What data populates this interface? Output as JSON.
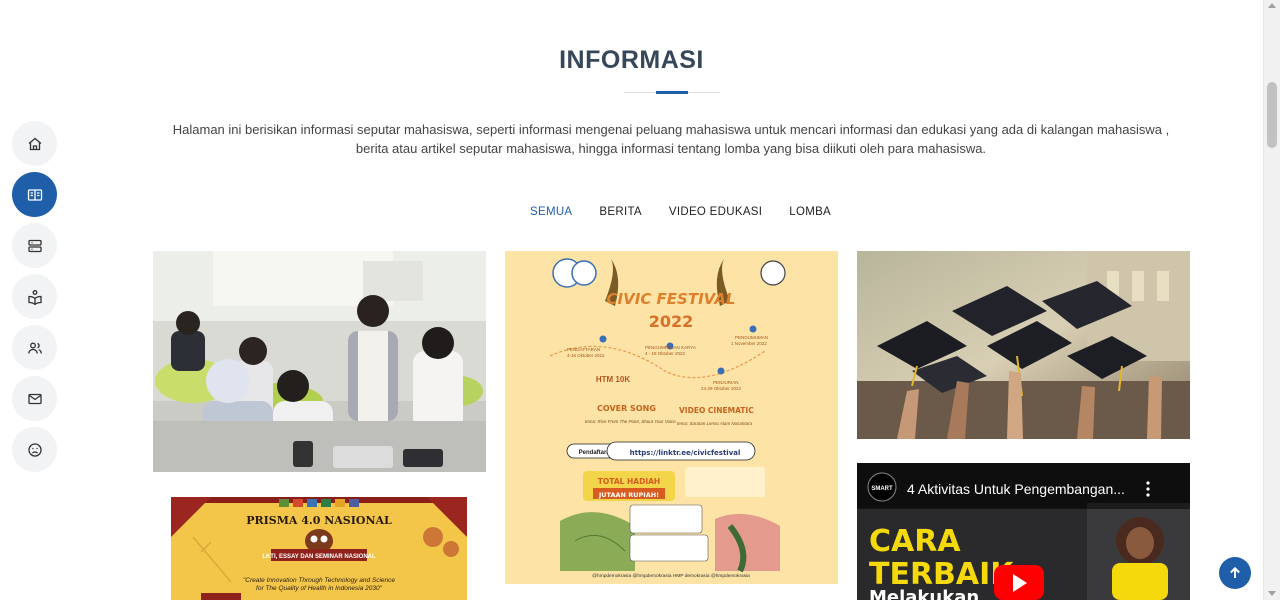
{
  "sidebar": {
    "items": [
      {
        "icon": "home-icon",
        "active": false
      },
      {
        "icon": "book-open-icon",
        "active": true
      },
      {
        "icon": "server-icon",
        "active": false
      },
      {
        "icon": "reading-icon",
        "active": false
      },
      {
        "icon": "people-icon",
        "active": false
      },
      {
        "icon": "mail-icon",
        "active": false
      },
      {
        "icon": "face-icon",
        "active": false
      }
    ]
  },
  "section": {
    "title": "INFORMASI",
    "description_line1": "Halaman ini berisikan informasi seputar mahasiswa, seperti informasi mengenai peluang mahasiswa untuk mencari informasi dan edukasi yang ada di kalangan mahasiswa ,",
    "description_line2": "berita atau artikel seputar mahasiswa, hingga informasi tentang lomba yang bisa diikuti oleh para mahasiswa."
  },
  "filters": [
    {
      "label": "SEMUA",
      "active": true
    },
    {
      "label": "BERITA",
      "active": false
    },
    {
      "label": "VIDEO EDUKASI",
      "active": false
    },
    {
      "label": "LOMBA",
      "active": false
    }
  ],
  "cards": {
    "civic": {
      "title_line1": "CIVIC FESTIVAL",
      "title_line2": "2022",
      "pendaftaran": "PENDAFTARAN",
      "pendaftaran_date": "4-16 Oktober 2022",
      "pengumpulan": "PENGUMPULAN KARYA",
      "pengumpulan_date": "4 - 18 Oktober 2022",
      "pengumuman": "PENGUMUMAN",
      "pengumuman_date": "1 November 2022",
      "penjurian": "PENJURIAN",
      "penjurian_date": "24-29 Oktober 2022",
      "htm": "HTM 10K",
      "cover_song": "COVER SONG",
      "cover_song_theme": "tema: Rise From The Point, Shout Your Voice",
      "video_cinematic": "VIDEO CINEMATIC",
      "video_cinematic_theme": "tema: Saratan Lenso Alam Nusantara",
      "pendaftaran_btn": "Pendaftaran",
      "link": "https://linktr.ee/civicfestival",
      "hadiah_line1": "TOTAL HADIAH",
      "hadiah_line2": "JUTAAN RUPIAH!",
      "footer": "@hmpdemokrasia   @hmpdemokrasia   HMP demokrasia   @hmpdemokrasia"
    },
    "prisma": {
      "title": "PRISMA 4.0 NASIONAL",
      "subtitle": "LKTI, ESSAY DAN SEMINAR NASIONAL",
      "tagline_line1": "\"Create Innovation Through Technology and Science",
      "tagline_line2": "for The Quality of Health in Indonesia 2030\""
    },
    "video": {
      "channel": "SMART",
      "title": "4 Aktivitas Untuk Pengembangan...",
      "overlay_line1": "CARA",
      "overlay_line2": "TERBAIK",
      "overlay_line3": "Melakukan"
    }
  },
  "colors": {
    "accent": "#1f5ea8",
    "heading": "#37475a",
    "civic_bg": "#fde3a6",
    "prisma_bg": "#f3c64a",
    "video_yellow": "#f5d90a",
    "youtube_red": "#ff0000"
  }
}
